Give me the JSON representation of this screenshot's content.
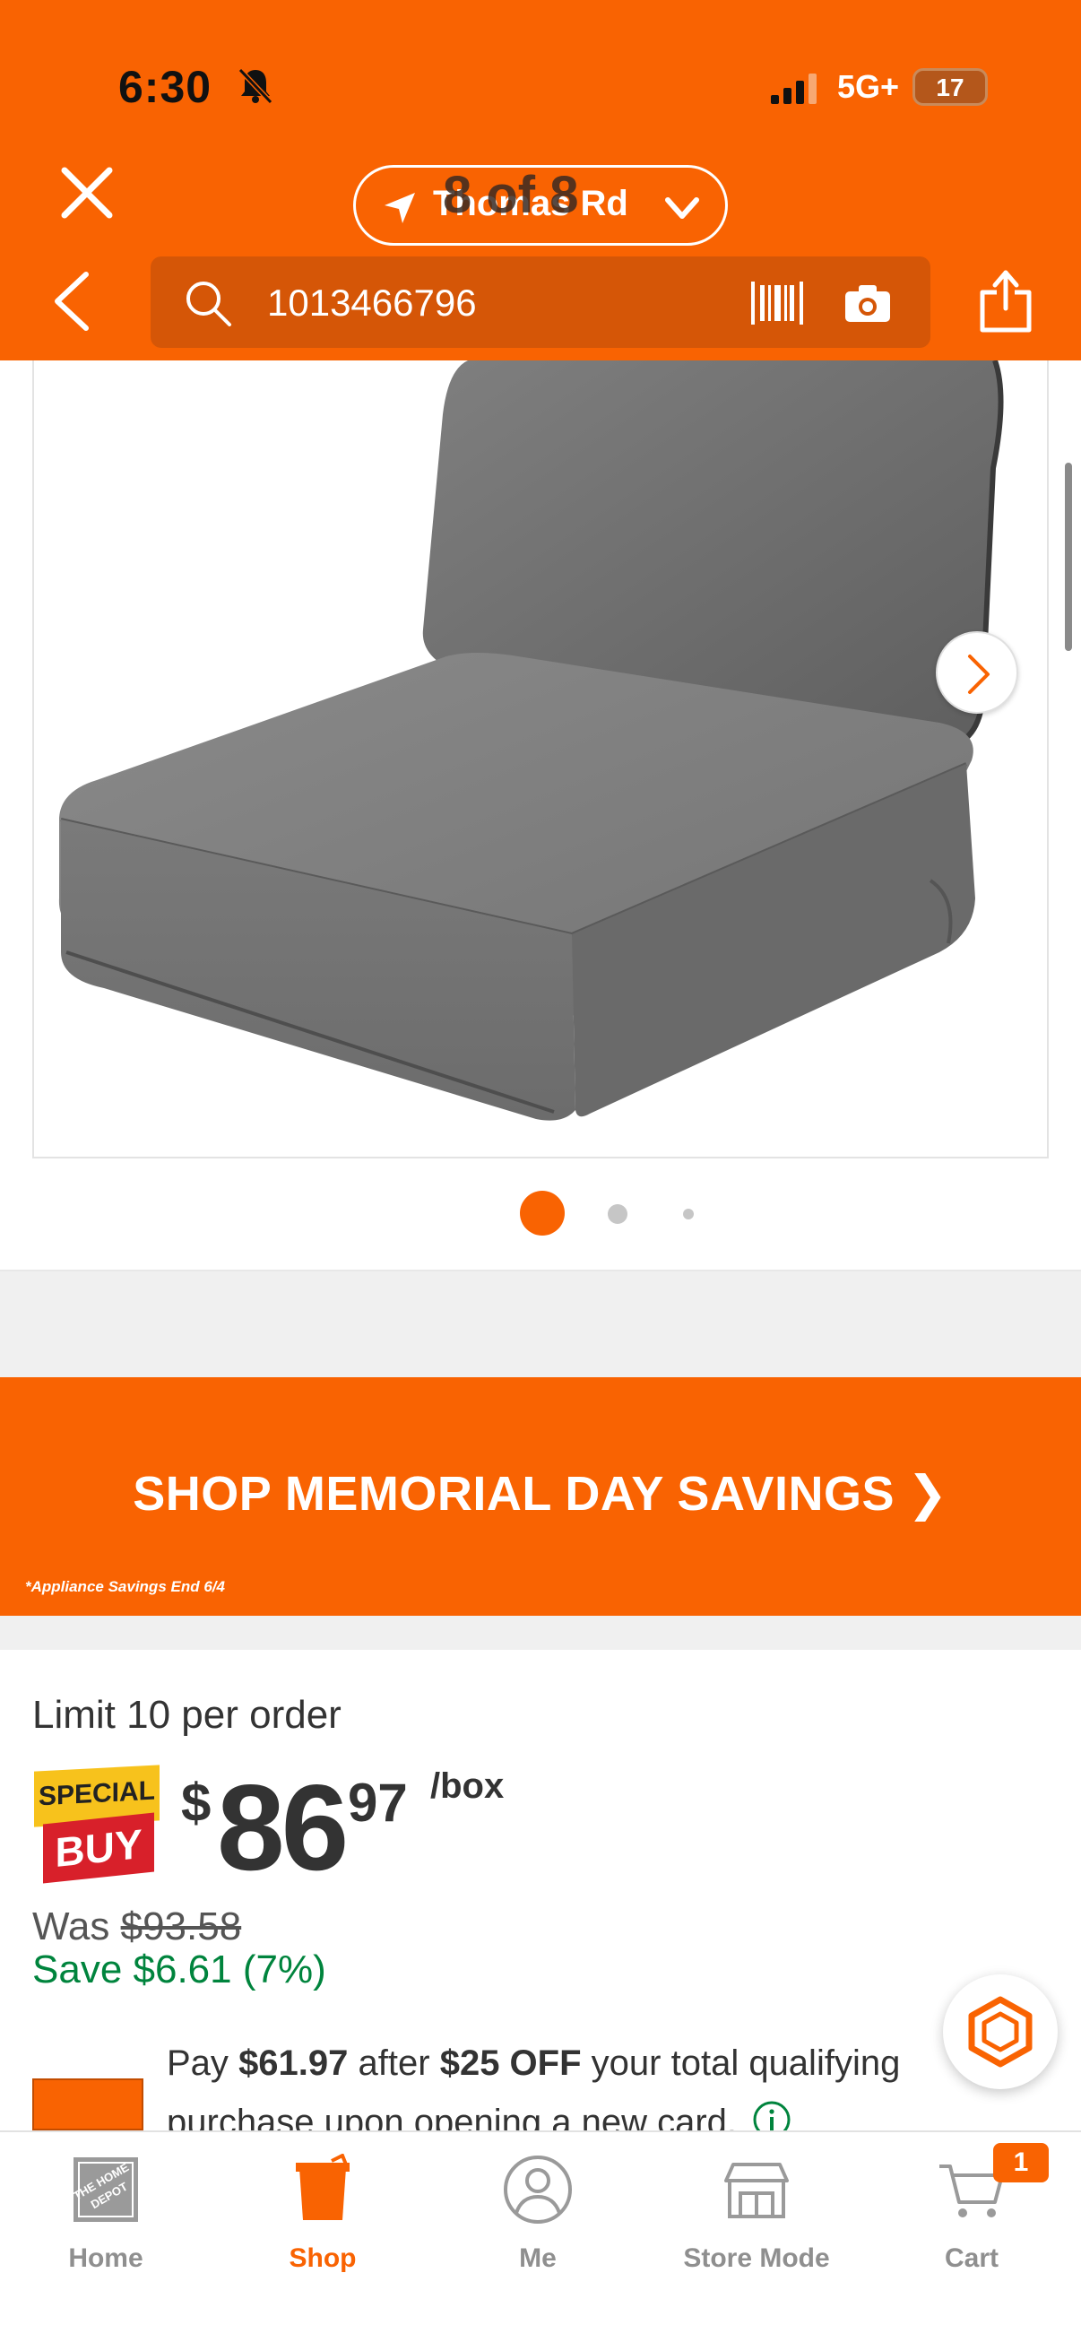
{
  "status_bar": {
    "time": "6:30",
    "network": "5G+",
    "battery": "17"
  },
  "header": {
    "store_name": "Thomas Rd",
    "image_counter": "8 of 8",
    "search_value": "1013466796",
    "accent_color": "#f96302"
  },
  "promo": {
    "text": "SHOP MEMORIAL DAY SAVINGS",
    "chevron": "❯",
    "note": "*Appliance Savings End 6/4"
  },
  "pricing": {
    "limit": "Limit 10 per order",
    "badge_top": "SPECIAL",
    "badge_bottom": "BUY",
    "currency": "$",
    "whole": "86",
    "cents": "97",
    "unit": "/box",
    "was_label": "Was",
    "was_price": "$93.58",
    "save": "Save $6.61 (7%)",
    "card_pay": "Pay",
    "card_amount": "$61.97",
    "card_after": "after",
    "card_off": "$25 OFF",
    "card_rest": "your total qualifying purchase upon opening a new card."
  },
  "gallery": {
    "active_dot": 1,
    "dot_count": 3
  },
  "nav": [
    {
      "label": "Home",
      "icon": "home-depot-logo-icon",
      "active": false
    },
    {
      "label": "Shop",
      "icon": "bucket-icon",
      "active": true
    },
    {
      "label": "Me",
      "icon": "person-icon",
      "active": false
    },
    {
      "label": "Store Mode",
      "icon": "store-icon",
      "active": false
    },
    {
      "label": "Cart",
      "icon": "cart-icon",
      "active": false
    }
  ],
  "cart_count": "1"
}
